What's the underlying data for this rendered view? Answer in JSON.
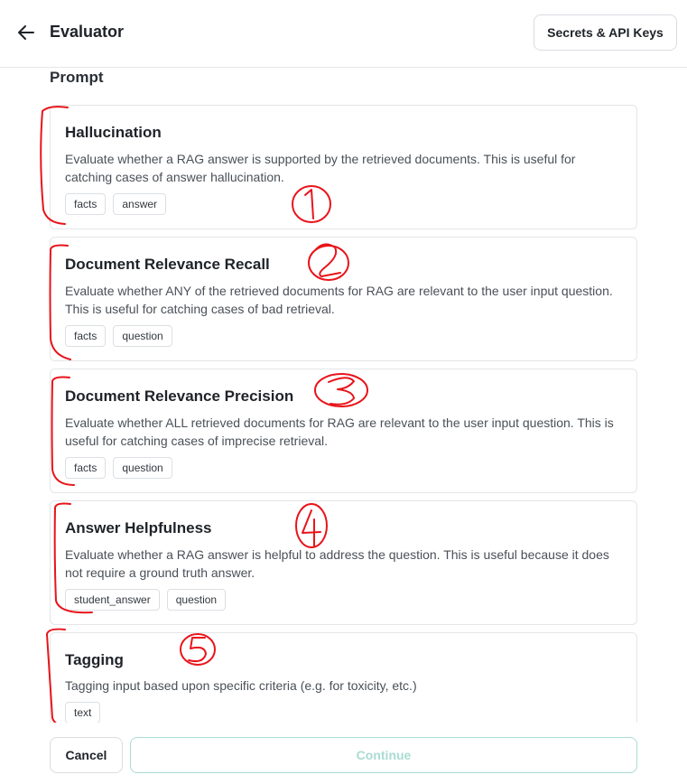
{
  "header": {
    "title": "Evaluator",
    "back_icon": "arrow-left-icon",
    "secrets_button": "Secrets & API Keys"
  },
  "section": {
    "label": "Prompt"
  },
  "cards": [
    {
      "title": "Hallucination",
      "description": "Evaluate whether a RAG answer is supported by the retrieved documents. This is useful for catching cases of answer hallucination.",
      "tags": [
        "facts",
        "answer"
      ],
      "annotation": "1"
    },
    {
      "title": "Document Relevance Recall",
      "description": "Evaluate whether ANY of the retrieved documents for RAG are relevant to the user input question. This is useful for catching cases of bad retrieval.",
      "tags": [
        "facts",
        "question"
      ],
      "annotation": "2"
    },
    {
      "title": "Document Relevance Precision",
      "description": "Evaluate whether ALL retrieved documents for RAG are relevant to the user input question. This is useful for catching cases of imprecise retrieval.",
      "tags": [
        "facts",
        "question"
      ],
      "annotation": "3"
    },
    {
      "title": "Answer Helpfulness",
      "description": "Evaluate whether a RAG answer is helpful to address the question. This is useful because it does not require a ground truth answer.",
      "tags": [
        "student_answer",
        "question"
      ],
      "annotation": "4"
    },
    {
      "title": "Tagging",
      "description": "Tagging input based upon specific criteria (e.g. for toxicity, etc.)",
      "tags": [
        "text"
      ],
      "annotation": "5"
    }
  ],
  "footer": {
    "cancel_label": "Cancel",
    "continue_label": "Continue"
  },
  "colors": {
    "annotation_ink": "#e8141b",
    "continue_disabled": "#a9dcd2",
    "border": "#e3e5e8"
  }
}
